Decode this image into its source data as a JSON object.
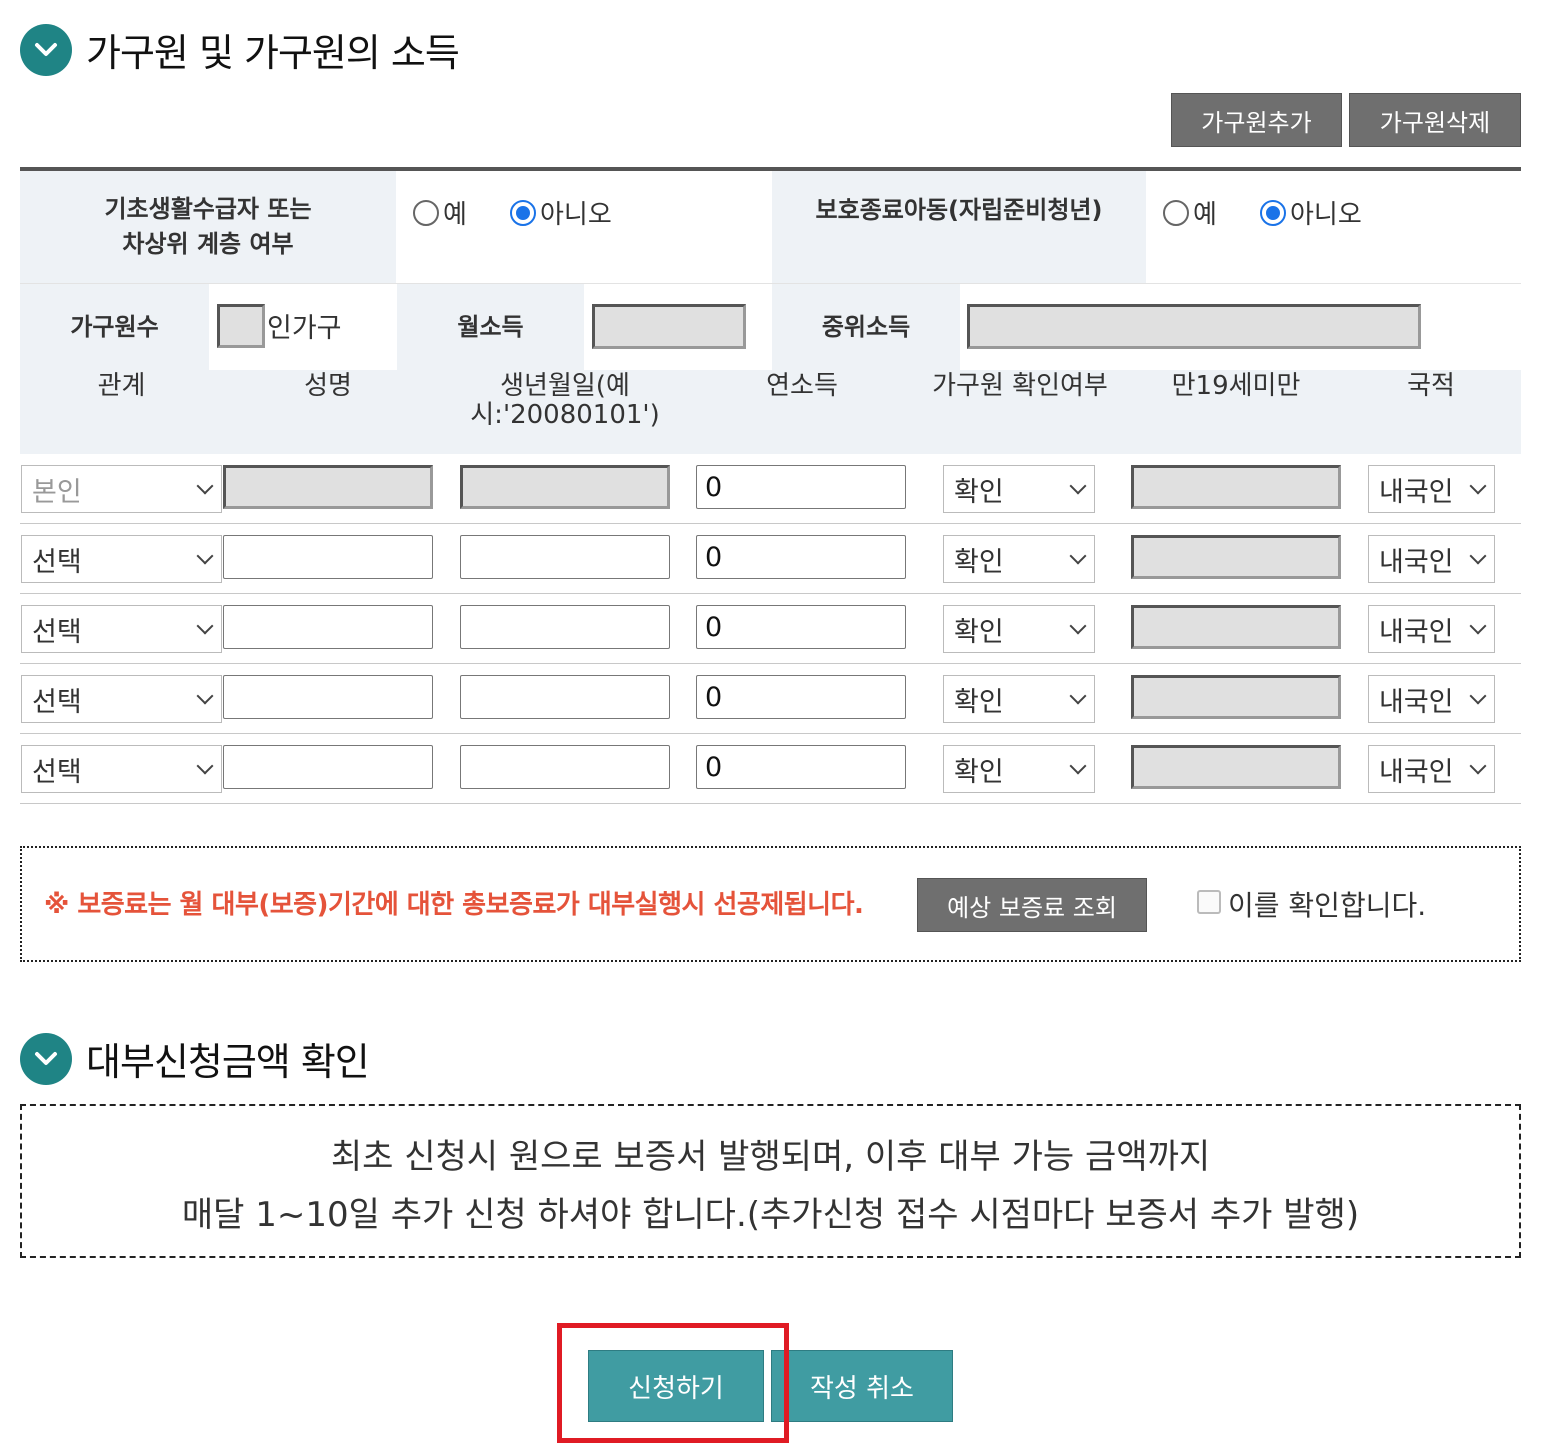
{
  "section1": {
    "title": "가구원 및 가구원의 소득"
  },
  "buttons": {
    "add_member": "가구원추가",
    "delete_member": "가구원삭제"
  },
  "basic_living": {
    "label_line1": "기초생활수급자 또는",
    "label_line2": "차상위 계층 여부",
    "yes": "예",
    "no": "아니오",
    "selected": "아니오"
  },
  "protection_end": {
    "label": "보호종료아동(자립준비청년)",
    "yes": "예",
    "no": "아니오",
    "selected": "아니오"
  },
  "household": {
    "count_label": "가구원수",
    "count_value": "",
    "count_suffix": "인가구",
    "monthly_income_label": "월소득",
    "monthly_income_value": "",
    "median_income_label": "중위소득",
    "median_income_value": ""
  },
  "table": {
    "headers": [
      "관계",
      "성명",
      "생년월일(예",
      "시:'20080101')",
      "연소득",
      "가구원 확인여부",
      "만19세미만",
      "국적"
    ],
    "rows": [
      {
        "relation": "본인",
        "name": "",
        "birth": "",
        "income": "0",
        "confirm": "확인",
        "under19": "",
        "nationality": "내국인"
      },
      {
        "relation": "선택",
        "name": "",
        "birth": "",
        "income": "0",
        "confirm": "확인",
        "under19": "",
        "nationality": "내국인"
      },
      {
        "relation": "선택",
        "name": "",
        "birth": "",
        "income": "0",
        "confirm": "확인",
        "under19": "",
        "nationality": "내국인"
      },
      {
        "relation": "선택",
        "name": "",
        "birth": "",
        "income": "0",
        "confirm": "확인",
        "under19": "",
        "nationality": "내국인"
      },
      {
        "relation": "선택",
        "name": "",
        "birth": "",
        "income": "0",
        "confirm": "확인",
        "under19": "",
        "nationality": "내국인"
      }
    ]
  },
  "notice": {
    "text": "※ 보증료는 월 대부(보증)기간에 대한 총보증료가 대부실행시 선공제됩니다.",
    "button": "예상 보증료 조회",
    "checkbox_label": "이를 확인합니다."
  },
  "section2": {
    "title": "대부신청금액 확인",
    "line1": "최초 신청시 원으로 보증서 발행되며, 이후 대부 가능 금액까지",
    "line2": "매달 1~10일 추가 신청 하셔야 합니다.(추가신청 접수 시점마다 보증서 추가 발행)"
  },
  "actions": {
    "submit": "신청하기",
    "cancel": "작성 취소"
  },
  "colors": {
    "teal": "#1f8485",
    "button_teal": "#409ca2",
    "notice_red": "#e5533a",
    "highlight": "#e01b24",
    "radio_blue": "#1a73e8"
  }
}
